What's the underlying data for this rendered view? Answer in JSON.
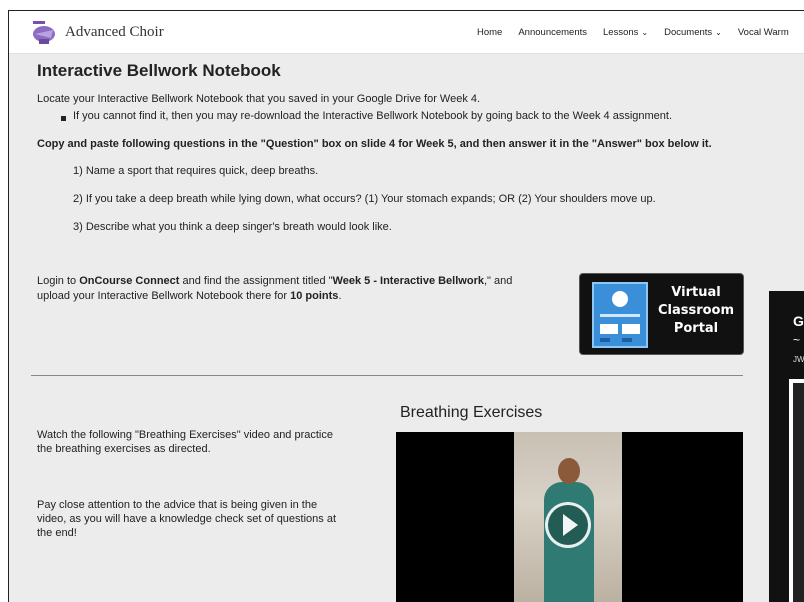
{
  "site": {
    "title": "Advanced Choir"
  },
  "nav": [
    {
      "label": "Home",
      "dropdown": false
    },
    {
      "label": "Announcements",
      "dropdown": false
    },
    {
      "label": "Lessons",
      "dropdown": true
    },
    {
      "label": "Documents",
      "dropdown": true
    },
    {
      "label": "Vocal Warm",
      "dropdown": false
    }
  ],
  "main": {
    "heading": "Interactive Bellwork Notebook",
    "intro": "Locate your Interactive Bellwork Notebook that you saved in your Google Drive for Week 4.",
    "bullet": "If you cannot find it, then you may re-download the Interactive Bellwork Notebook by going back to the Week 4 assignment.",
    "instruction": "Copy and paste following questions in the \"Question\" box on slide 4 for Week 5, and then answer it in the \"Answer\" box below it.",
    "questions": [
      "1) Name a sport that requires quick, deep breaths.",
      "2) If you take a deep breath while lying down, what occurs? (1) Your stomach expands;  OR  (2) Your shoulders move up.",
      "3) Describe what you think a deep singer's breath would look like."
    ],
    "login": {
      "pre": "Login to ",
      "app": "OnCourse Connect",
      "mid": " and find the assignment titled \"",
      "assignment": "Week 5 - Interactive Bellwork",
      "post": ",\" and",
      "line2_pre": "upload your Interactive Bellwork Notebook there for ",
      "points": "10 points",
      "line2_post": "."
    },
    "portal": {
      "line1": "Virtual",
      "line2": "Classroom",
      "line3": "Portal"
    },
    "watch_text_1": "Watch the following \"Breathing Exercises\" video and practice",
    "watch_text_2": "the breathing exercises as directed.",
    "advice_1": "Pay close attention to the advice that is being given in the",
    "advice_2": "video, as  you will have a knowledge check set of questions at",
    "advice_3": "the end!",
    "video_title": "Breathing Exercises"
  },
  "side": {
    "letter": "G",
    "tilde": "~",
    "small": "JW"
  },
  "colors": {
    "page_bg": "#ececec",
    "header_bg": "#ffffff",
    "portal_bg": "#111111",
    "portal_screen": "#3b8fd8"
  }
}
